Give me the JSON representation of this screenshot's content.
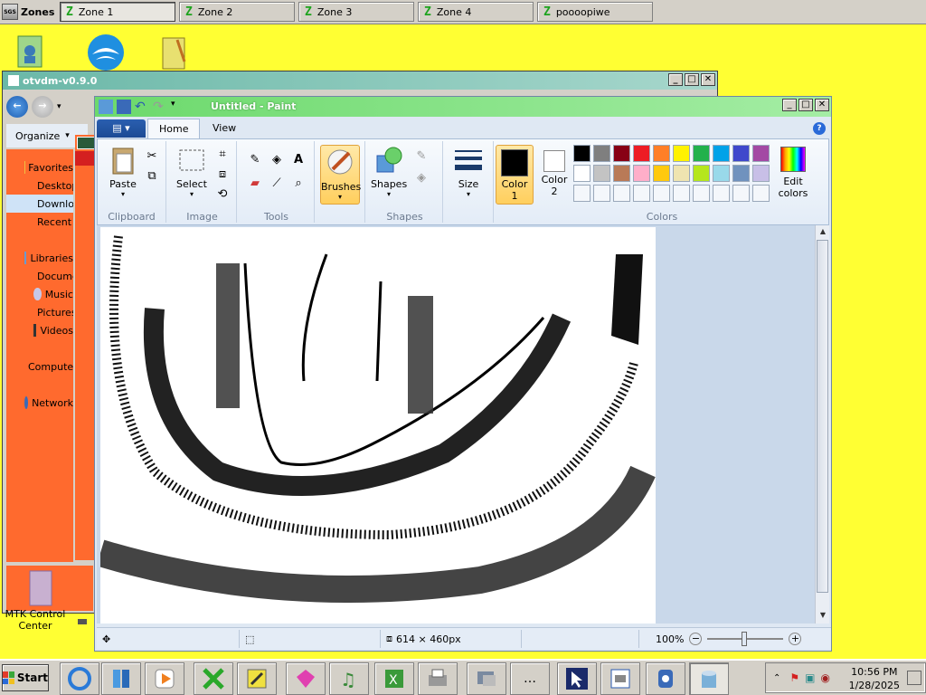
{
  "zones": {
    "logo_label": "Zones",
    "tabs": [
      {
        "label": "Zone 1",
        "active": true
      },
      {
        "label": "Zone 2",
        "active": false
      },
      {
        "label": "Zone 3",
        "active": false
      },
      {
        "label": "Zone 4",
        "active": false
      },
      {
        "label": "poooopiwe",
        "active": false
      }
    ]
  },
  "otvdm": {
    "title": "otvdm-v0.9.0",
    "organize_label": "Organize",
    "sidebar": [
      {
        "label": "Favorites"
      },
      {
        "label": "Desktop"
      },
      {
        "label": "Downloads"
      },
      {
        "label": "Recent Places"
      },
      {
        "label": "Libraries"
      },
      {
        "label": "Documents"
      },
      {
        "label": "Music"
      },
      {
        "label": "Pictures"
      },
      {
        "label": "Videos"
      },
      {
        "label": "Computer"
      },
      {
        "label": "Network"
      }
    ]
  },
  "paint": {
    "title": "Untitled - Paint",
    "tabs": {
      "home": "Home",
      "view": "View"
    },
    "groups": {
      "clipboard": "Clipboard",
      "image": "Image",
      "tools": "Tools",
      "shapes": "Shapes",
      "colors": "Colors"
    },
    "buttons": {
      "paste": "Paste",
      "select": "Select",
      "brushes": "Brushes",
      "shapes": "Shapes",
      "size": "Size",
      "color1": "Color 1",
      "color2": "Color 2",
      "edit_colors": "Edit colors"
    },
    "palette": [
      "#000000",
      "#7f7f7f",
      "#880015",
      "#ed1c24",
      "#ff7f27",
      "#fff200",
      "#22b14c",
      "#00a2e8",
      "#3f48cc",
      "#a349a4",
      "#ffffff",
      "#c3c3c3",
      "#b97a57",
      "#ffaec9",
      "#ffc90e",
      "#efe4b0",
      "#b5e61d",
      "#99d9ea",
      "#7092be",
      "#c8bfe7"
    ],
    "status": {
      "dimensions": "614 × 460px",
      "zoom": "100%"
    }
  },
  "taskbar": {
    "start_label": "Start",
    "clock_time": "10:56 PM",
    "clock_date": "1/28/2025"
  },
  "desktop": {
    "mtk_label": "MTK Control Center"
  }
}
